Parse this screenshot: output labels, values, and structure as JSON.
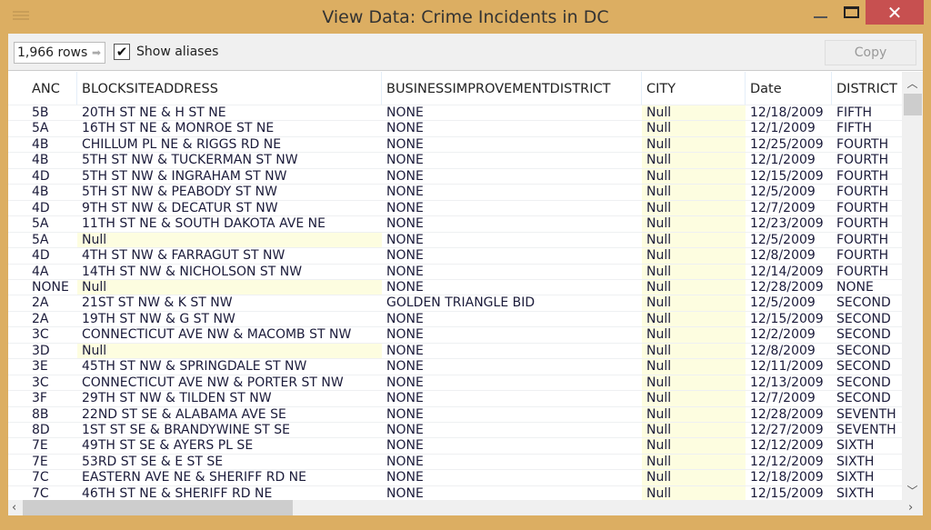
{
  "window": {
    "title": "View Data:  Crime Incidents in DC",
    "close": "✕"
  },
  "toolbar": {
    "row_count": "1,966 rows",
    "show_aliases_label": "Show aliases",
    "show_aliases_checked": true,
    "copy_label": "Copy"
  },
  "columns": [
    "ANC",
    "BLOCKSITEADDRESS",
    "BUSINESSIMPROVEMENTDISTRICT",
    "CITY",
    "Date",
    "DISTRICT"
  ],
  "rows": [
    [
      "5B",
      "20TH ST NE & H ST NE",
      "NONE",
      "Null",
      "12/18/2009",
      "FIFTH"
    ],
    [
      "5A",
      "16TH ST NE & MONROE ST NE",
      "NONE",
      "Null",
      "12/1/2009",
      "FIFTH"
    ],
    [
      "4B",
      "CHILLUM PL NE & RIGGS RD NE",
      "NONE",
      "Null",
      "12/25/2009",
      "FOURTH"
    ],
    [
      "4B",
      "5TH ST NW & TUCKERMAN ST NW",
      "NONE",
      "Null",
      "12/1/2009",
      "FOURTH"
    ],
    [
      "4D",
      "5TH ST NW & INGRAHAM ST NW",
      "NONE",
      "Null",
      "12/15/2009",
      "FOURTH"
    ],
    [
      "4B",
      "5TH ST NW & PEABODY ST NW",
      "NONE",
      "Null",
      "12/5/2009",
      "FOURTH"
    ],
    [
      "4D",
      "9TH ST NW & DECATUR ST NW",
      "NONE",
      "Null",
      "12/7/2009",
      "FOURTH"
    ],
    [
      "5A",
      "11TH ST NE & SOUTH DAKOTA AVE NE",
      "NONE",
      "Null",
      "12/23/2009",
      "FOURTH"
    ],
    [
      "5A",
      "Null",
      "NONE",
      "Null",
      "12/5/2009",
      "FOURTH"
    ],
    [
      "4D",
      "4TH ST NW & FARRAGUT ST NW",
      "NONE",
      "Null",
      "12/8/2009",
      "FOURTH"
    ],
    [
      "4A",
      "14TH ST NW & NICHOLSON ST NW",
      "NONE",
      "Null",
      "12/14/2009",
      "FOURTH"
    ],
    [
      "NONE",
      "Null",
      "NONE",
      "Null",
      "12/28/2009",
      "NONE"
    ],
    [
      "2A",
      "21ST ST NW & K ST NW",
      "GOLDEN TRIANGLE BID",
      "Null",
      "12/5/2009",
      "SECOND"
    ],
    [
      "2A",
      "19TH ST NW & G ST NW",
      "NONE",
      "Null",
      "12/15/2009",
      "SECOND"
    ],
    [
      "3C",
      "CONNECTICUT AVE NW & MACOMB ST NW",
      "NONE",
      "Null",
      "12/2/2009",
      "SECOND"
    ],
    [
      "3D",
      "Null",
      "NONE",
      "Null",
      "12/8/2009",
      "SECOND"
    ],
    [
      "3E",
      "45TH ST NW & SPRINGDALE ST NW",
      "NONE",
      "Null",
      "12/11/2009",
      "SECOND"
    ],
    [
      "3C",
      "CONNECTICUT AVE NW & PORTER ST NW",
      "NONE",
      "Null",
      "12/13/2009",
      "SECOND"
    ],
    [
      "3F",
      "29TH ST NW & TILDEN ST NW",
      "NONE",
      "Null",
      "12/7/2009",
      "SECOND"
    ],
    [
      "8B",
      "22ND ST SE & ALABAMA AVE SE",
      "NONE",
      "Null",
      "12/28/2009",
      "SEVENTH"
    ],
    [
      "8D",
      "1ST ST SE & BRANDYWINE ST SE",
      "NONE",
      "Null",
      "12/27/2009",
      "SEVENTH"
    ],
    [
      "7E",
      "49TH ST SE & AYERS PL SE",
      "NONE",
      "Null",
      "12/12/2009",
      "SIXTH"
    ],
    [
      "7E",
      "53RD ST SE & E ST SE",
      "NONE",
      "Null",
      "12/12/2009",
      "SIXTH"
    ],
    [
      "7C",
      "EASTERN AVE NE & SHERIFF RD NE",
      "NONE",
      "Null",
      "12/18/2009",
      "SIXTH"
    ],
    [
      "7C",
      "46TH ST NE & SHERIFF RD NE",
      "NONE",
      "Null",
      "12/15/2009",
      "SIXTH"
    ]
  ],
  "colors": {
    "frame": "#dcae62",
    "close": "#c75050",
    "null_cell": "#fdfde0"
  }
}
